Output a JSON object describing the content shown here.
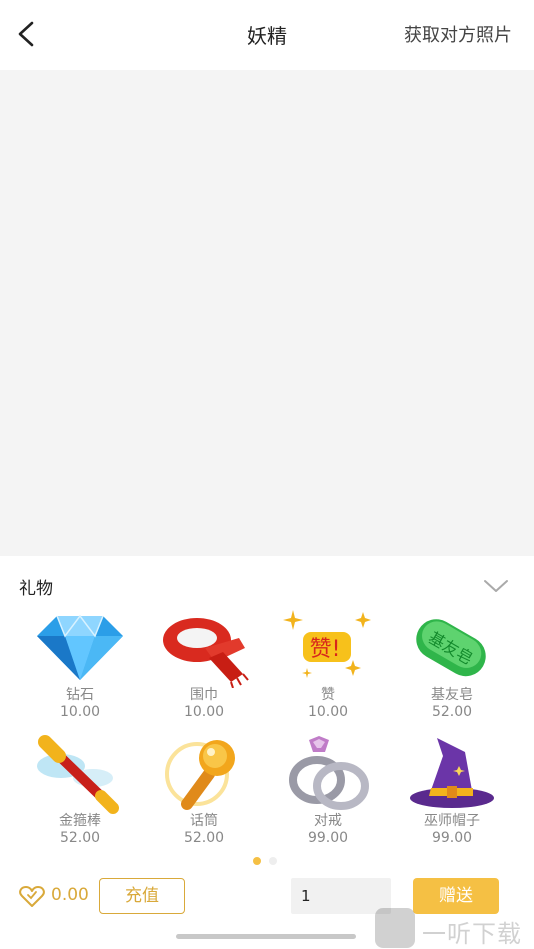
{
  "header": {
    "title": "妖精",
    "action": "获取对方照片"
  },
  "panel": {
    "title": "礼物"
  },
  "gifts": [
    {
      "name": "钻石",
      "price": "10.00",
      "icon": "diamond-icon"
    },
    {
      "name": "围巾",
      "price": "10.00",
      "icon": "scarf-icon"
    },
    {
      "name": "赞",
      "price": "10.00",
      "icon": "like-sparkle-icon"
    },
    {
      "name": "基友皂",
      "price": "52.00",
      "icon": "soap-icon"
    },
    {
      "name": "金箍棒",
      "price": "52.00",
      "icon": "golden-staff-icon"
    },
    {
      "name": "话筒",
      "price": "52.00",
      "icon": "microphone-icon"
    },
    {
      "name": "对戒",
      "price": "99.00",
      "icon": "rings-icon"
    },
    {
      "name": "巫师帽子",
      "price": "99.00",
      "icon": "wizard-hat-icon"
    }
  ],
  "pager": {
    "pages": 2,
    "current": 1
  },
  "footer": {
    "balance": "0.00",
    "recharge_label": "充值",
    "quantity": "1",
    "send_label": "赠送"
  },
  "watermark": {
    "text": "一听下载",
    "badge": "听"
  },
  "colors": {
    "accent": "#f5c044",
    "accent_text": "#d9a93a",
    "photo_bg": "#f4f4f4"
  }
}
